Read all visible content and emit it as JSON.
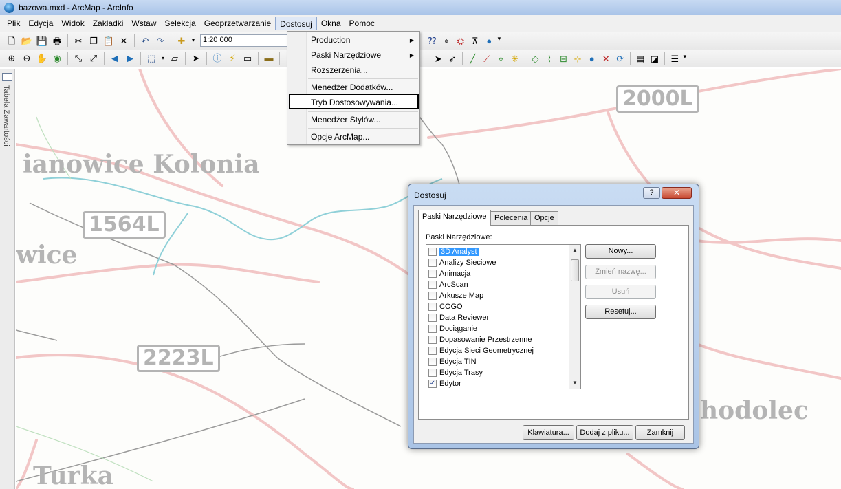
{
  "window": {
    "title": "bazowa.mxd - ArcMap - ArcInfo"
  },
  "menubar": [
    "Plik",
    "Edycja",
    "Widok",
    "Zakładki",
    "Wstaw",
    "Selekcja",
    "Geoprzetwarzanie",
    "Dostosuj",
    "Okna",
    "Pomoc"
  ],
  "toolbar": {
    "scale_value": "1:20 000"
  },
  "toc": {
    "label": "Tabela Zawartości"
  },
  "map": {
    "place_labels": [
      "ianowice Kolonia",
      "wice",
      "Turka",
      "hodolec"
    ],
    "road_labels": [
      "2000L",
      "1564L",
      "2223L"
    ]
  },
  "dropdown": {
    "items": [
      "Production",
      "Paski Narzędziowe",
      "Rozszerzenia...",
      "Menedżer Dodatków...",
      "Tryb Dostosowywania...",
      "Menedżer Stylów...",
      "Opcje ArcMap..."
    ],
    "submenu_arrow": "▶"
  },
  "dialog": {
    "title": "Dostosuj",
    "help": "?",
    "close": "✕",
    "tabs": [
      "Paski Narzędziowe",
      "Polecenia",
      "Opcje"
    ],
    "list_label": "Paski Narzędziowe:",
    "toolbars": [
      {
        "name": "3D Analyst",
        "checked": false,
        "selected": true
      },
      {
        "name": "Analizy Sieciowe",
        "checked": false
      },
      {
        "name": "Animacja",
        "checked": false
      },
      {
        "name": "ArcScan",
        "checked": false
      },
      {
        "name": "Arkusze Map",
        "checked": false
      },
      {
        "name": "COGO",
        "checked": false
      },
      {
        "name": "Data Reviewer",
        "checked": false
      },
      {
        "name": "Dociąganie",
        "checked": false
      },
      {
        "name": "Dopasowanie Przestrzenne",
        "checked": false
      },
      {
        "name": "Edycja Sieci Geometrycznej",
        "checked": false
      },
      {
        "name": "Edycja TIN",
        "checked": false
      },
      {
        "name": "Edycja Trasy",
        "checked": false
      },
      {
        "name": "Edytor",
        "checked": true
      }
    ],
    "side_buttons": {
      "new": "Nowy...",
      "rename": "Zmień nazwę...",
      "delete": "Usuń",
      "reset": "Resetuj..."
    },
    "bottom_buttons": {
      "keyboard": "Klawiatura...",
      "add_from_file": "Dodaj z pliku...",
      "close": "Zamknij"
    },
    "check_mark": "✓"
  }
}
